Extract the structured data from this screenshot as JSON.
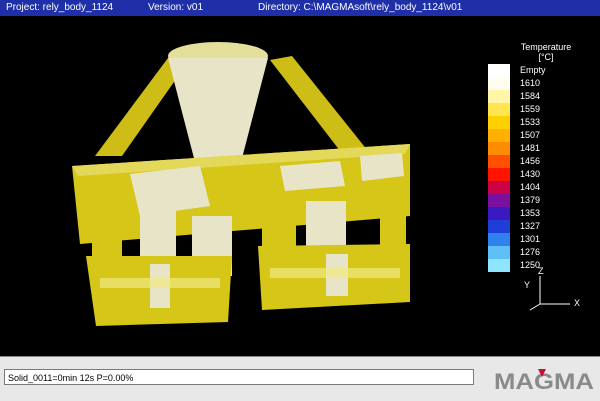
{
  "titlebar": {
    "project": "Project: rely_body_1124",
    "version": "Version: v01",
    "directory": "Directory: C:\\MAGMAsoft\\rely_body_1124\\v01"
  },
  "legend": {
    "title_line1": "Temperature",
    "title_line2": "[°C]",
    "items": [
      {
        "label": "Empty",
        "color": "#ffffff"
      },
      {
        "label": "1610",
        "color": "#fffdf0"
      },
      {
        "label": "1584",
        "color": "#fff6a8"
      },
      {
        "label": "1559",
        "color": "#ffe650"
      },
      {
        "label": "1533",
        "color": "#ffd000"
      },
      {
        "label": "1507",
        "color": "#ffb000"
      },
      {
        "label": "1481",
        "color": "#ff8c00"
      },
      {
        "label": "1456",
        "color": "#ff5000"
      },
      {
        "label": "1430",
        "color": "#ff1400"
      },
      {
        "label": "1404",
        "color": "#cc0044"
      },
      {
        "label": "1379",
        "color": "#7a10a0"
      },
      {
        "label": "1353",
        "color": "#3a1ac0"
      },
      {
        "label": "1327",
        "color": "#1f3ed8"
      },
      {
        "label": "1301",
        "color": "#2f82ee"
      },
      {
        "label": "1276",
        "color": "#5fc0f8"
      },
      {
        "label": "1250",
        "color": "#8fe4ff"
      }
    ]
  },
  "axes": {
    "z": "Z",
    "y": "Y",
    "x": "X"
  },
  "status": {
    "text": "Solid_0011=0min 12s P=0.00%"
  },
  "logo": {
    "text": "MAGMA"
  },
  "colors": {
    "casting_yellow": "#d8c81a",
    "solid_beige": "#e8e4c8",
    "brand_red": "#c8102e"
  }
}
